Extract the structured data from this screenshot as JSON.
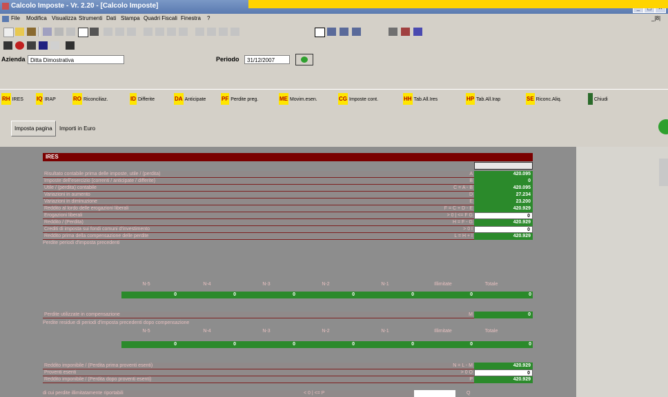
{
  "window": {
    "title": "Calcolo Imposte - Vr. 2.20 - [Calcolo Imposte]",
    "buttons": [
      "_",
      "▢",
      "✕"
    ],
    "child_buttons": "_|8|"
  },
  "menu": [
    "File",
    "Modifica",
    "Visualizza",
    "Strumenti",
    "Dati",
    "Stampa",
    "Quadri Fiscali",
    "Finestra",
    "?"
  ],
  "azienda": {
    "label": "Azienda",
    "value": "Ditta Dimostrativa"
  },
  "periodo": {
    "label": "Periodo",
    "value": "31/12/2007"
  },
  "tabs": [
    {
      "code": "RH",
      "label": "IRES"
    },
    {
      "code": "IQ",
      "label": "IRAP"
    },
    {
      "code": "RO",
      "label": "Riconciliaz."
    },
    {
      "code": "ID",
      "label": "Differite"
    },
    {
      "code": "DA",
      "label": "Anticipate"
    },
    {
      "code": "PF",
      "label": "Perdite preg."
    },
    {
      "code": "ME",
      "label": "Movim.esen."
    },
    {
      "code": "CG",
      "label": "Imposte cont."
    },
    {
      "code": "HH",
      "label": "Tab.All.Ires"
    },
    {
      "code": "HP",
      "label": "Tab.All.Irap"
    },
    {
      "code": "SE",
      "label": "Riconc.Aliq."
    },
    {
      "code": "",
      "label": "Chiudi"
    }
  ],
  "buttons": {
    "imposta_pagina": "Imposta pagina",
    "importi_euro": "Importi in Euro"
  },
  "ires": {
    "header": "IRES",
    "rows": [
      {
        "label": "Risultato contabile prima delle imposte, utile / (perdita)",
        "code": "A",
        "value": "420.095",
        "style": "green"
      },
      {
        "label": "Imposte dell'esercizio (correnti / anticipate / differite)",
        "code": "B",
        "value": "0",
        "style": "green"
      },
      {
        "label": "Utile / (perdita) contabile",
        "code": "C = A - B",
        "value": "420.095",
        "style": "green"
      },
      {
        "label": "Variazioni in aumento",
        "code": "D",
        "value": "27.234",
        "style": "green"
      },
      {
        "label": "Variazioni in diminuzione",
        "code": "E",
        "value": "23.200",
        "style": "green"
      },
      {
        "label": "Reddito al lordo delle erogazioni liberali",
        "code": "F = C + D - E",
        "value": "420.929",
        "style": "green"
      },
      {
        "label": "Erogazioni liberali",
        "code": "> 0 | <= F        G",
        "value": "0",
        "style": "white"
      },
      {
        "label": "Reddito / (Perdita)",
        "code": "H = F - G",
        "value": "420.929",
        "style": "green"
      },
      {
        "label": "Crediti di imposta sui fondi comuni d'investimento",
        "code": "> 0        I",
        "value": "0",
        "style": "white"
      },
      {
        "label": "Reddito prima della compensazione delle perdite",
        "code": "L = H + I",
        "value": "420.929",
        "style": "green"
      }
    ],
    "perdite_prec_label": "Perdite periodi d'imposta precedenti",
    "col_headers": [
      "N-5",
      "N-4",
      "N-3",
      "N-2",
      "N-1",
      "Illimitate",
      "Totale"
    ],
    "perdite_prec_values": [
      "0",
      "0",
      "0",
      "0",
      "0",
      "0",
      "0"
    ],
    "perdite_utilizzate": {
      "label": "Perdite utilizzate in compensazione",
      "code": "M",
      "value": "0"
    },
    "perdite_residue_label": "Perdite residue di periodi d'imposta precedenti dopo compensazione",
    "col_headers2": [
      "N-5",
      "N-4",
      "N-3",
      "N-2",
      "N-1",
      "Illimitate",
      "Totale"
    ],
    "perdite_residue_values": [
      "0",
      "0",
      "0",
      "0",
      "0",
      "0",
      "0"
    ],
    "rows2": [
      {
        "label": "Reddito imponibile / (Perdita prima proventi esenti)",
        "code": "N = L - M",
        "value": "420.929",
        "style": "green"
      },
      {
        "label": "Proventi esenti",
        "code": "> 0        O",
        "value": "0",
        "style": "white"
      },
      {
        "label": "Reddito imponibile / (Perdita dopo proventi esenti)",
        "code": "P",
        "value": "420.929",
        "style": "green"
      }
    ],
    "last_row": {
      "label": "di cui perdite illimitatamente riportabili",
      "code": "< 0 | <= P",
      "code2": "Q"
    }
  },
  "colors": {
    "green": "#2b8a2b",
    "header_red": "#7a0000",
    "tab_code_yellow": "#ffe600",
    "accent_yellow": "#ffd400"
  }
}
